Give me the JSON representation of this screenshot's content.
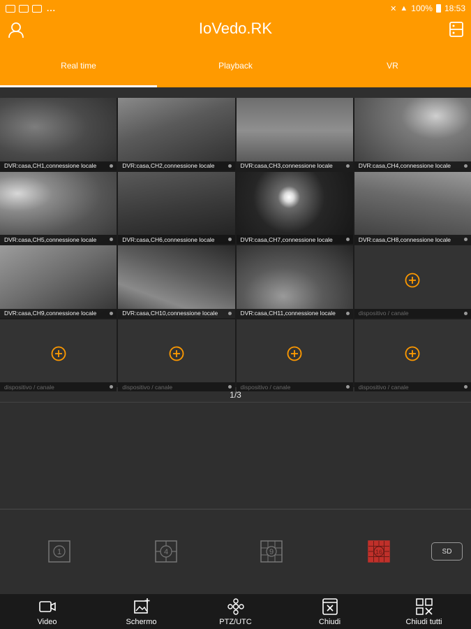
{
  "status_bar": {
    "time": "18:53",
    "battery": "100%",
    "more": "..."
  },
  "app": {
    "title": "IoVedo.RK"
  },
  "tabs": [
    {
      "label": "Real time",
      "active": true
    },
    {
      "label": "Playback",
      "active": false
    },
    {
      "label": "VR",
      "active": false
    }
  ],
  "grid": {
    "cameras": [
      {
        "label": "DVR:casa,CH1,connessione locale",
        "selected": true
      },
      {
        "label": "DVR:casa,CH2,connessione locale"
      },
      {
        "label": "DVR:casa,CH3,connessione locale"
      },
      {
        "label": "DVR:casa,CH4,connessione locale"
      },
      {
        "label": "DVR:casa,CH5,connessione locale"
      },
      {
        "label": "DVR:casa,CH6,connessione locale"
      },
      {
        "label": "DVR:casa,CH7,connessione locale"
      },
      {
        "label": "DVR:casa,CH8,connessione locale"
      },
      {
        "label": "DVR:casa,CH9,connessione locale"
      },
      {
        "label": "DVR:casa,CH10,connessione locale"
      },
      {
        "label": "DVR:casa,CH11,connessione locale"
      }
    ],
    "empty_label": "dispositivo / canale",
    "empty_count": 5
  },
  "pager": {
    "text": "1/3"
  },
  "splits": [
    {
      "label": "1",
      "active": false
    },
    {
      "label": "4",
      "active": false
    },
    {
      "label": "9",
      "active": false
    },
    {
      "label": "16",
      "active": true
    }
  ],
  "sd_label": "SD",
  "toolbar": [
    {
      "label": "Video",
      "icon": "video-icon"
    },
    {
      "label": "Schermo",
      "icon": "screenshot-icon"
    },
    {
      "label": "PTZ/UTC",
      "icon": "ptz-icon"
    },
    {
      "label": "Chiudi",
      "icon": "close-window-icon"
    },
    {
      "label": "Chiudi tutti",
      "icon": "close-all-icon"
    }
  ],
  "colors": {
    "accent": "#ff9a00",
    "active_split": "#c0302a",
    "add": "#ff9a00"
  }
}
